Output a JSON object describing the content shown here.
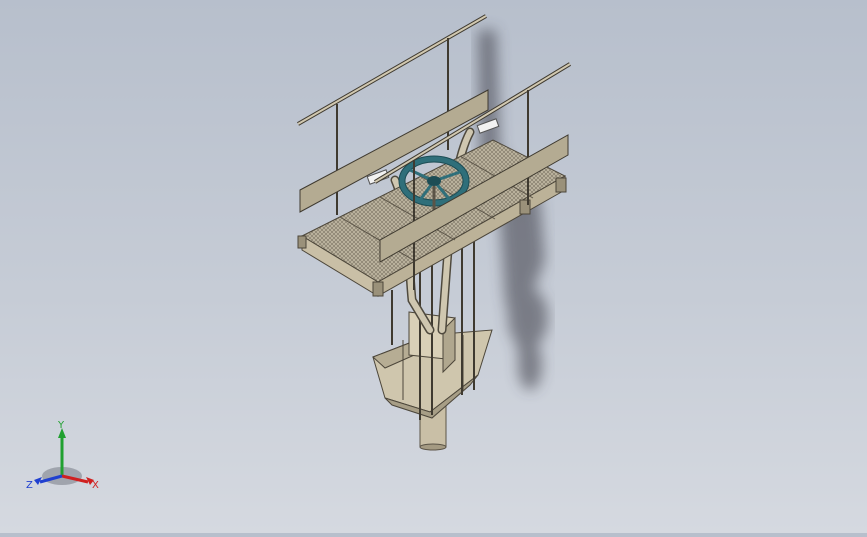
{
  "viewport": {
    "background_top": "#b7bfcc",
    "background_bottom": "#d5d9e0"
  },
  "model": {
    "steel_color": "#c9bfa6",
    "steel_dark": "#5b5447",
    "grating_color": "#a9a190",
    "handwheel_color": "#2f6f7a",
    "shadow_color": "#3a3a44"
  },
  "triad": {
    "x_label": "X",
    "y_label": "Y",
    "z_label": "Z",
    "x_color": "#d02020",
    "y_color": "#20a030",
    "z_color": "#2040d0"
  }
}
